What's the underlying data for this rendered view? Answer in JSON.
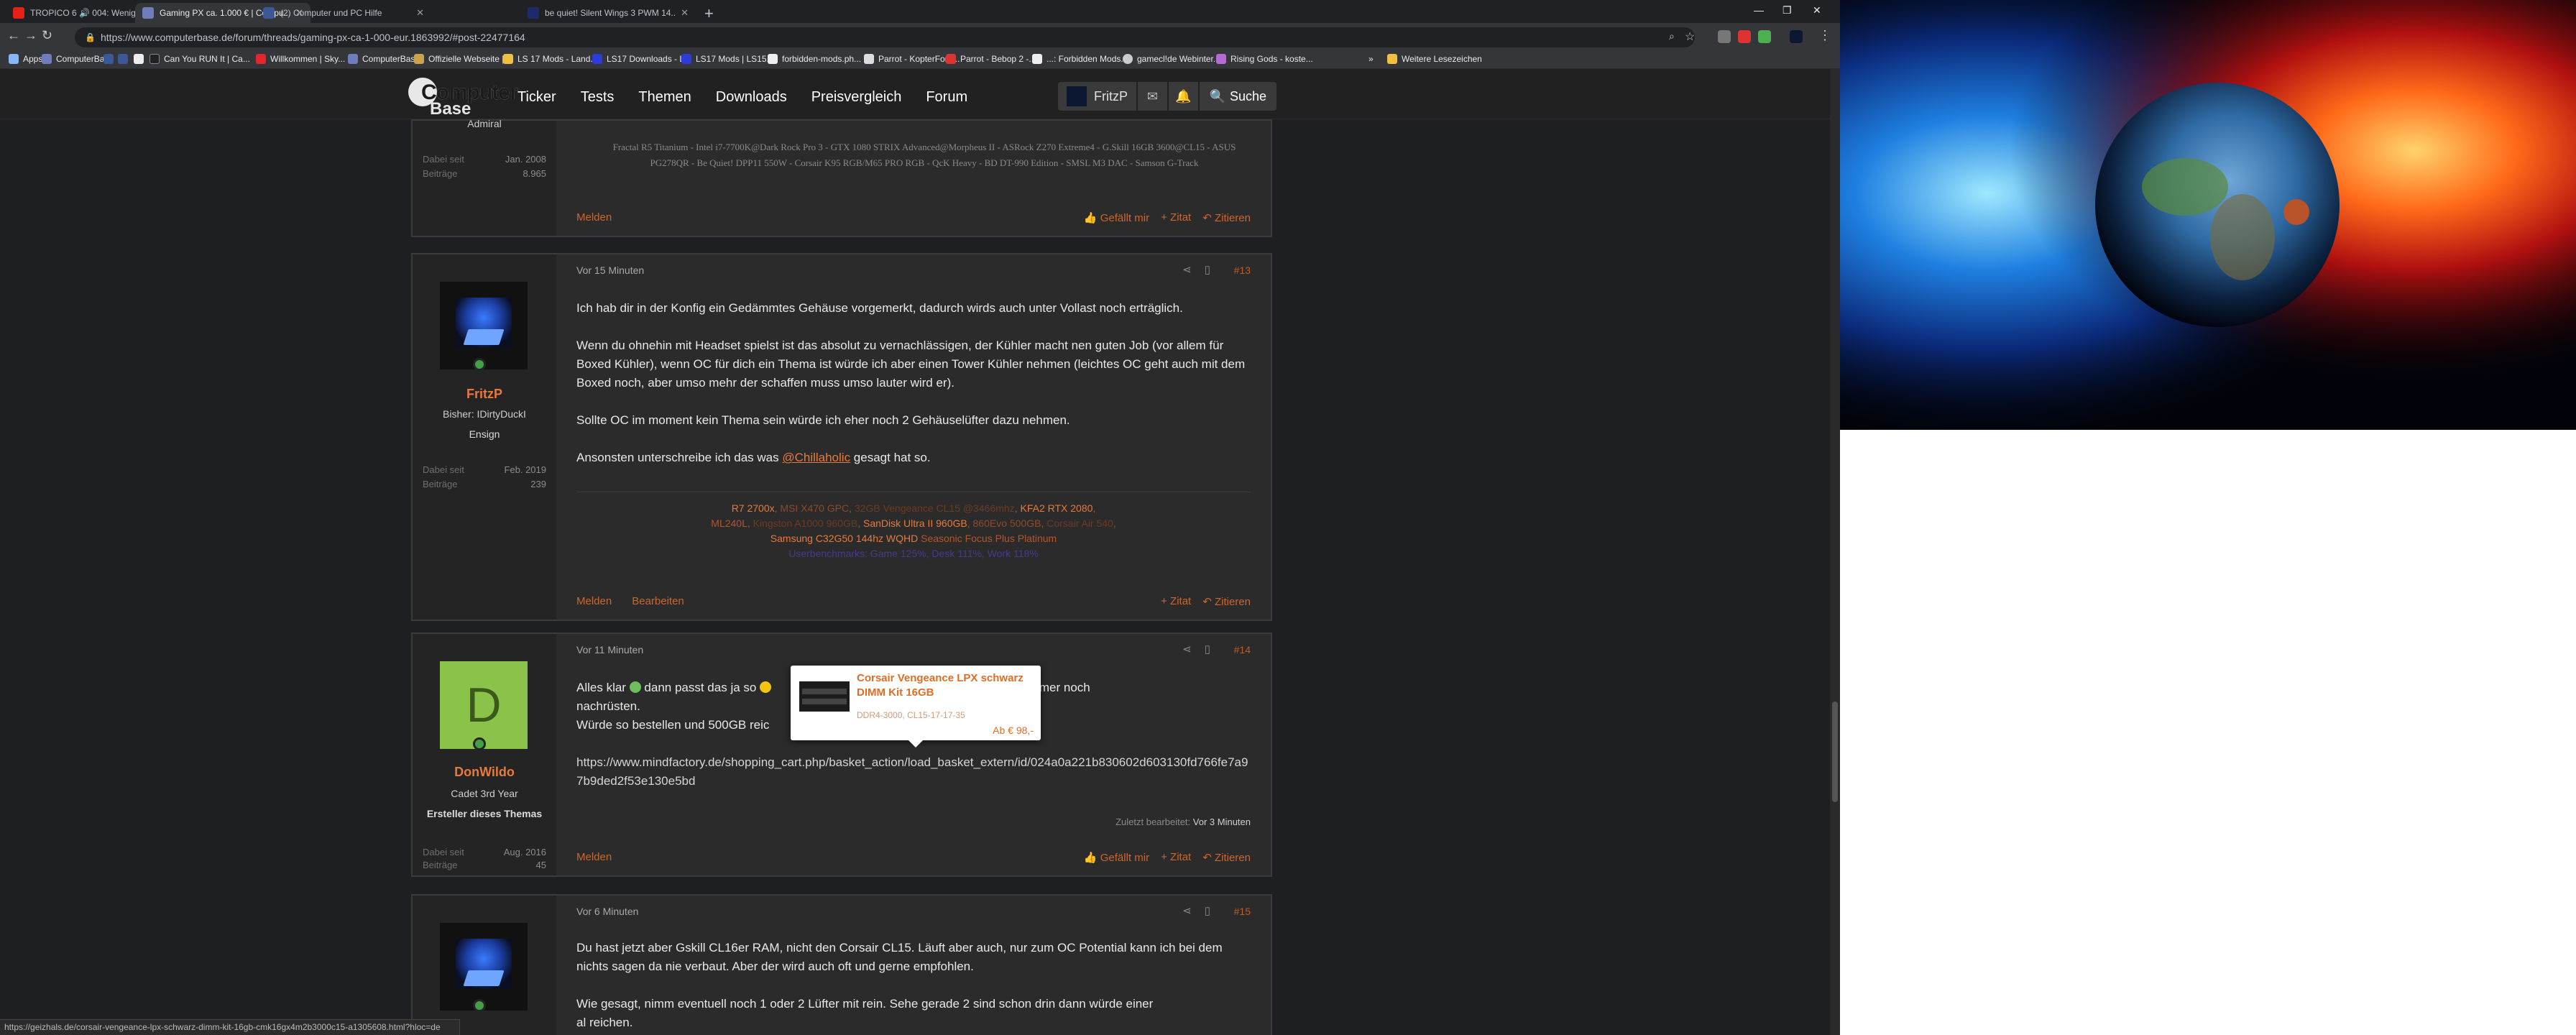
{
  "browser": {
    "tabs": [
      {
        "title": "TROPICO 6 🔊 004: Wenig G..."
      },
      {
        "title": "Gaming PX ca. 1.000 € | Compu..."
      },
      {
        "title": "(2) Computer und PC Hilfe"
      },
      {
        "title": "be quiet! Silent Wings 3 PWM 14..."
      }
    ],
    "url": "https://www.computerbase.de/forum/threads/gaming-px-ca-1-000-eur.1863992/#post-22477164",
    "bookmarks": [
      "Apps",
      "ComputerBase",
      "Can You RUN It | Ca...",
      "Willkommen | Sky...",
      "ComputerBase",
      "Offizielle Webseite |...",
      "LS 17 Mods - Land...",
      "LS17 Downloads - L...",
      "LS17 Mods | LS15...",
      "forbidden-mods.ph...",
      "Parrot - KopterForu...",
      "Parrot - Bebop 2 -...",
      "...: Forbidden Mods...",
      "gamecl!de Webinter...",
      "Rising Gods - koste..."
    ],
    "bookmarks_more": "»",
    "other_bookmarks": "Weitere Lesezeichen",
    "status_url": "https://geizhals.de/corsair-vengeance-lpx-schwarz-dimm-kit-16gb-cmk16gx4m2b3000c15-a1305608.html?hloc=de"
  },
  "site": {
    "logo_line1": "Computer",
    "logo_line2": "Base",
    "nav": [
      "Ticker",
      "Tests",
      "Themen",
      "Downloads",
      "Preisvergleich",
      "Forum"
    ],
    "user": "FritzP",
    "search": "Suche"
  },
  "post_top": {
    "role": "Admiral",
    "stats": [
      {
        "label": "Dabei seit",
        "value": "Jan. 2008"
      },
      {
        "label": "Beiträge",
        "value": "8.965"
      }
    ],
    "signature": "Fractal R5 Titanium - Intel i7-7700K@Dark Rock Pro 3 - GTX 1080 STRIX Advanced@Morpheus II - ASRock Z270 Extreme4 - G.Skill 16GB 3600@CL15 - ASUS PG278QR - Be Quiet! DPP11 550W - Corsair K95 RGB/M65 PRO RGB - QcK Heavy - BD DT-990 Edition - SMSL M3 DAC - Samson G-Track",
    "actions_left": [
      "Melden"
    ],
    "actions_right": [
      "Gefällt mir",
      "Zitat",
      "Zitieren"
    ]
  },
  "post_13": {
    "time": "Vor 15 Minuten",
    "number": "#13",
    "author": "FritzP",
    "title": "Bisher: IDirtyDuckI",
    "rank": "Ensign",
    "stats": [
      {
        "label": "Dabei seit",
        "value": "Feb. 2019"
      },
      {
        "label": "Beiträge",
        "value": "239"
      }
    ],
    "p1": "Ich hab dir in der Konfig ein Gedämmtes Gehäuse vorgemerkt, dadurch wirds auch unter Vollast noch erträglich.",
    "p2": "Wenn du ohnehin mit Headset spielst ist das absolut zu vernachlässigen, der Kühler macht nen guten Job (vor allem für Boxed Kühler), wenn OC für dich ein Thema ist würde ich aber einen Tower Kühler nehmen (leichtes OC geht auch mit dem Boxed noch, aber umso mehr der schaffen muss umso lauter wird er).",
    "p3": "Sollte OC im moment kein Thema sein würde ich eher noch 2 Gehäuselüfter dazu nehmen.",
    "p4_pre": "Ansonsten unterschreibe ich das was ",
    "p4_mention": "@Chillaholic",
    "p4_post": " gesagt hat so.",
    "sig_line1": [
      {
        "t": "R7 2700x",
        "c": "#e8793a"
      },
      {
        "t": ", ",
        "c": "#9b5a35"
      },
      {
        "t": "MSI X470 GPC",
        "c": "#8f4a28"
      },
      {
        "t": ", ",
        "c": "#9b5a35"
      },
      {
        "t": "32GB Vengeance CL15 @3466mhz",
        "c": "#6d3a22"
      },
      {
        "t": ", ",
        "c": "#9b5a35"
      },
      {
        "t": "KFA2 RTX 2080",
        "c": "#e8793a"
      },
      {
        "t": ",",
        "c": "#9b5a35"
      }
    ],
    "sig_line2": [
      {
        "t": "ML240L",
        "c": "#b8542a"
      },
      {
        "t": ", ",
        "c": "#9b5a35"
      },
      {
        "t": "Kingston A1000 960GB",
        "c": "#6d3a22"
      },
      {
        "t": ", ",
        "c": "#9b5a35"
      },
      {
        "t": "SanDisk Ultra II 960GB",
        "c": "#e8793a"
      },
      {
        "t": ", ",
        "c": "#9b5a35"
      },
      {
        "t": "860Evo 500GB",
        "c": "#8f4a28"
      },
      {
        "t": ", ",
        "c": "#9b5a35"
      },
      {
        "t": "Corsair Air 540",
        "c": "#6d3a22"
      },
      {
        "t": ",",
        "c": "#9b5a35"
      }
    ],
    "sig_line3": [
      {
        "t": "Samsung C32G50 144hz WQHD",
        "c": "#e8793a"
      },
      {
        "t": "  ",
        "c": "#9b5a35"
      },
      {
        "t": "Seasonic Focus Plus Platinum",
        "c": "#b8542a"
      }
    ],
    "sig_line4": "Userbenchmarks: Game 125%, Desk 111%, Work 118%",
    "actions_left": [
      "Melden",
      "Bearbeiten"
    ],
    "actions_right": [
      "Zitat",
      "Zitieren"
    ]
  },
  "post_14": {
    "time": "Vor 11 Minuten",
    "number": "#14",
    "author_initial": "D",
    "author": "DonWildo",
    "title": "Cadet 3rd Year",
    "rank": "Ersteller dieses Themas",
    "stats": [
      {
        "label": "Dabei seit",
        "value": "Aug. 2016"
      },
      {
        "label": "Beiträge",
        "value": "45"
      }
    ],
    "line1a": "Alles klar ",
    "line1b": " dann passt das ja so ",
    "line1c": "nn man dann ja immer noch",
    "line2": "nachrüsten.",
    "line3": "Würde so bestellen und 500GB reic",
    "link": "https://www.mindfactory.de/shopping_cart.php/basket_action/load_basket_extern/id/024a0a221b830602d603130fd766fe7a97b9ded2f53e130e5bd",
    "edited_label": "Zuletzt bearbeitet:",
    "edited_value": "Vor 3 Minuten",
    "actions_left": [
      "Melden"
    ],
    "actions_right": [
      "Gefällt mir",
      "Zitat",
      "Zitieren"
    ]
  },
  "popup": {
    "title": "Corsair Vengeance LPX schwarz DIMM Kit 16GB",
    "spec": "DDR4-3000, CL15-17-17-35",
    "price": "Ab € 98,-"
  },
  "post_15": {
    "time": "Vor 6 Minuten",
    "number": "#15",
    "p1": "Du hast jetzt aber Gskill CL16er RAM, nicht den Corsair CL15. Läuft aber auch, nur zum OC Potential kann ich bei dem nichts sagen da nie verbaut. Aber der wird auch oft und gerne empfohlen.",
    "p2": "Wie gesagt, nimm eventuell noch 1 oder 2 Lüfter mit rein. Sehe gerade 2 sind schon drin dann würde einer",
    "p3": "al reichen."
  },
  "colors": {
    "accent": "#e8793a",
    "page_bg": "#1e1f22",
    "post_bg": "#2b2b2b",
    "sidebar_bg": "#242424"
  }
}
